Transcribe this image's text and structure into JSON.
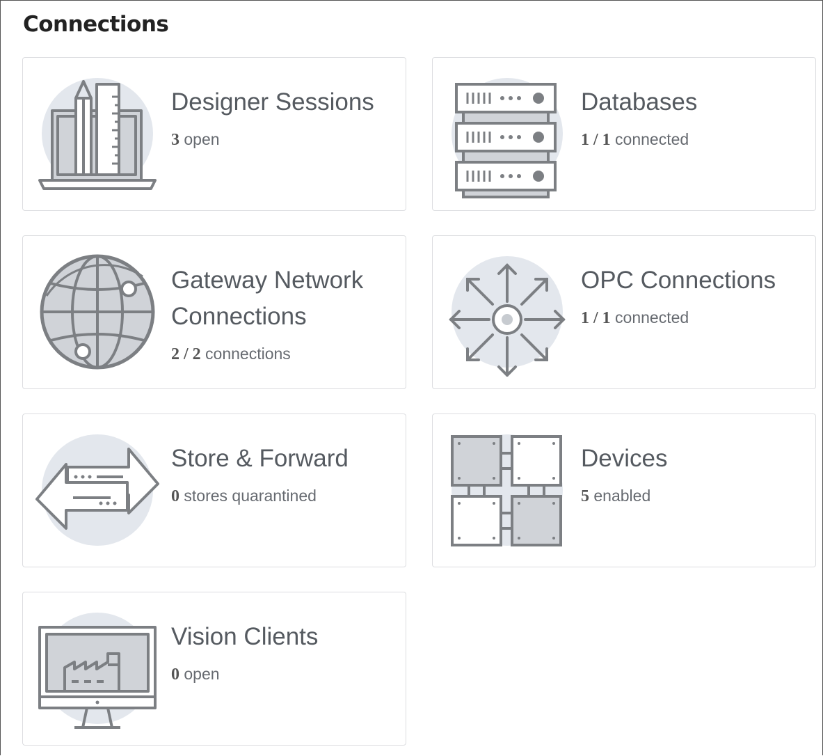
{
  "section": {
    "title": "Connections"
  },
  "cards": [
    {
      "title": "Designer Sessions",
      "count": "3",
      "sub": " open",
      "icon": "designer-icon"
    },
    {
      "title": "Databases",
      "count": "1 / 1",
      "sub": " connected",
      "icon": "database-icon"
    },
    {
      "title": "Gateway Network Connections",
      "count": "2 / 2",
      "sub": " connections",
      "icon": "globe-network-icon"
    },
    {
      "title": "OPC Connections",
      "count": "1 / 1",
      "sub": " connected",
      "icon": "opc-arrows-icon"
    },
    {
      "title": "Store & Forward",
      "count": "0",
      "sub": " stores quarantined",
      "icon": "store-forward-arrows-icon"
    },
    {
      "title": "Devices",
      "count": "5",
      "sub": " enabled",
      "icon": "devices-grid-icon"
    },
    {
      "title": "Vision Clients",
      "count": "0",
      "sub": " open",
      "icon": "vision-monitor-icon"
    }
  ],
  "colors": {
    "icon_stroke": "#7c7f83",
    "icon_circle": "#e3e7ed",
    "icon_fill": "#d0d3d8",
    "card_border": "#dcdde0"
  }
}
